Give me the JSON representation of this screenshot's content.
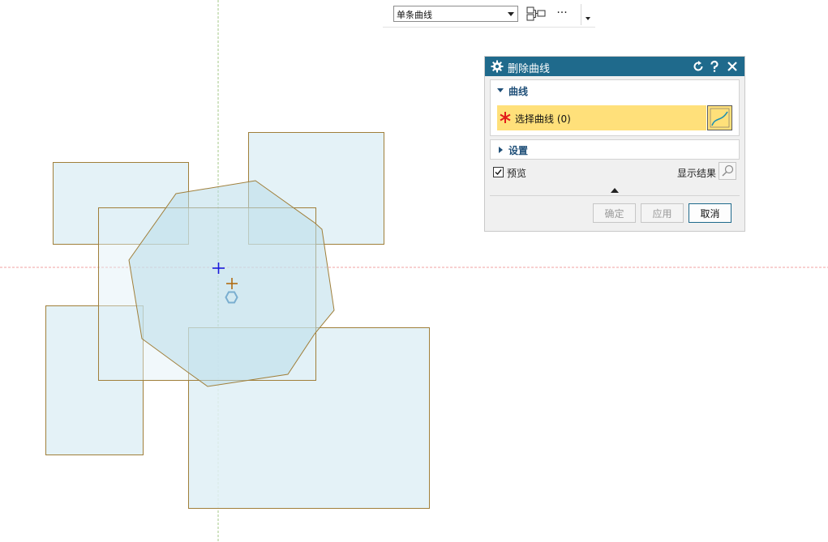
{
  "toolbar": {
    "filter_value": "单条曲线",
    "more_label": "···"
  },
  "dialog": {
    "title": "删除曲线",
    "section_curve": "曲线",
    "select_label": "选择曲线 (0)",
    "section_settings": "设置",
    "preview_label": "预览",
    "preview_checked": true,
    "show_result_label": "显示结果",
    "ok_label": "确定",
    "apply_label": "应用",
    "cancel_label": "取消"
  },
  "colors": {
    "title_bar": "#1f6a8c",
    "section_text": "#1f4f78",
    "selection_highlight": "#ffe07a",
    "shape_fill": "#dff0f6",
    "shape_stroke": "#a07f3a",
    "required_star": "#e21b1b",
    "wcs_origin": "#1a1adc",
    "datum_line_red": "#f0a0a0",
    "datum_line_green": "#a6c98a"
  }
}
